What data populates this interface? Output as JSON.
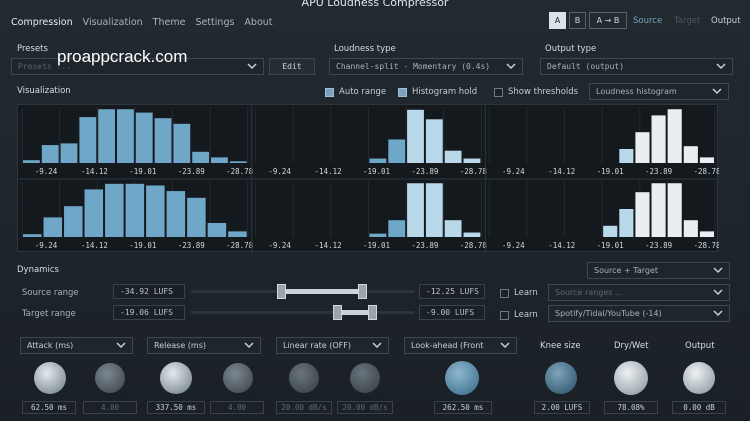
{
  "window": {
    "title": "APU Loudness Compressor"
  },
  "watermark": "proappcrack.com",
  "nav": {
    "tabs": [
      "Compression",
      "Visualization",
      "Theme",
      "Settings",
      "About"
    ],
    "active": "Compression"
  },
  "ab": {
    "a": "A",
    "b": "B",
    "a_to_b": "A → B",
    "source": "Source",
    "target": "Target",
    "output": "Output"
  },
  "presets": {
    "label": "Presets",
    "placeholder": "Presets ...",
    "edit": "Edit"
  },
  "loudness_type": {
    "label": "Loudness type",
    "value": "Channel-split - Momentary (0.4s)"
  },
  "output_type": {
    "label": "Output type",
    "value": "Default (output)"
  },
  "visualization": {
    "label": "Visualization",
    "auto_range": "Auto range",
    "histogram_hold": "Histogram hold",
    "show_thresholds": "Show thresholds",
    "mode": "Loudness histogram",
    "auto_range_on": true,
    "histogram_hold_on": true,
    "show_thresholds_on": false,
    "ticks": [
      "-9.24",
      "-14.12",
      "-19.01",
      "-23.89",
      "-28.78"
    ]
  },
  "dynamics": {
    "label": "Dynamics",
    "mode": "Source + Target",
    "source_range_label": "Source range",
    "source_min": "-34.92 LUFS",
    "source_max": "-12.25 LUFS",
    "target_range_label": "Target range",
    "target_min": "-19.06 LUFS",
    "target_max": "-9.00 LUFS",
    "learn": "Learn",
    "source_preset": "Source ranges ...",
    "target_preset": "Spotify/Tidal/YouTube (-14)"
  },
  "params": {
    "attack": {
      "label": "Attack (ms)",
      "value": "62.50 ms",
      "sub_value": "4.00"
    },
    "release": {
      "label": "Release (ms)",
      "value": "337.50 ms",
      "sub_value": "4.00"
    },
    "linear_rate": {
      "label": "Linear rate (OFF)",
      "value_a": "20.00 dB/s",
      "value_b": "20.00 dB/s"
    },
    "lookahead": {
      "label": "Look-ahead (Front",
      "value": "262.50 ms"
    },
    "knee": {
      "label": "Knee size",
      "value": "2.00 LUFS"
    },
    "drywet": {
      "label": "Dry/Wet",
      "value": "78.08%"
    },
    "output": {
      "label": "Output",
      "value": "0.00 dB"
    }
  },
  "colors": {
    "bar_blue": "#6fa7c8",
    "bar_light": "#b9d8ea",
    "bar_white": "#e8eef2",
    "bg": "#1b2127",
    "accent": "#7ba3bd"
  },
  "chart_data": [
    {
      "type": "bar",
      "categories": [
        "-9.24",
        "-14.12",
        "-19.01",
        "-23.89",
        "-28.78"
      ],
      "series": [
        {
          "values": [
            0.05,
            0.32,
            0.35,
            0.82,
            0.96,
            0.96,
            0.9,
            0.8,
            0.7,
            0.2,
            0.1,
            0.03
          ]
        }
      ]
    },
    {
      "type": "bar",
      "categories": [
        "-9.24",
        "-14.12",
        "-19.01",
        "-23.89",
        "-28.78"
      ],
      "series": [
        {
          "values": [
            0.0,
            0.0,
            0.0,
            0.0,
            0.0,
            0.0,
            0.08,
            0.42,
            0.95,
            0.78,
            0.22,
            0.08
          ]
        }
      ]
    },
    {
      "type": "bar",
      "categories": [
        "-9.24",
        "-14.12",
        "-19.01",
        "-23.89",
        "-28.78"
      ],
      "series": [
        {
          "values": [
            0.0,
            0.0,
            0.0,
            0.0,
            0.0,
            0.0,
            0.0,
            0.0,
            0.25,
            0.55,
            0.85,
            0.96,
            0.3,
            0.1
          ]
        }
      ]
    },
    {
      "type": "bar",
      "categories": [
        "-9.24",
        "-14.12",
        "-19.01",
        "-23.89",
        "-28.78"
      ],
      "series": [
        {
          "values": [
            0.05,
            0.35,
            0.55,
            0.85,
            0.95,
            0.95,
            0.92,
            0.82,
            0.7,
            0.25,
            0.1
          ]
        }
      ]
    },
    {
      "type": "bar",
      "categories": [
        "-9.24",
        "-14.12",
        "-19.01",
        "-23.89",
        "-28.78"
      ],
      "series": [
        {
          "values": [
            0.0,
            0.0,
            0.0,
            0.0,
            0.0,
            0.0,
            0.06,
            0.3,
            0.96,
            0.96,
            0.3,
            0.08
          ]
        }
      ]
    },
    {
      "type": "bar",
      "categories": [
        "-9.24",
        "-14.12",
        "-19.01",
        "-23.89",
        "-28.78"
      ],
      "series": [
        {
          "values": [
            0.0,
            0.0,
            0.0,
            0.0,
            0.0,
            0.0,
            0.0,
            0.2,
            0.5,
            0.8,
            0.96,
            0.96,
            0.3,
            0.1
          ]
        }
      ]
    }
  ]
}
